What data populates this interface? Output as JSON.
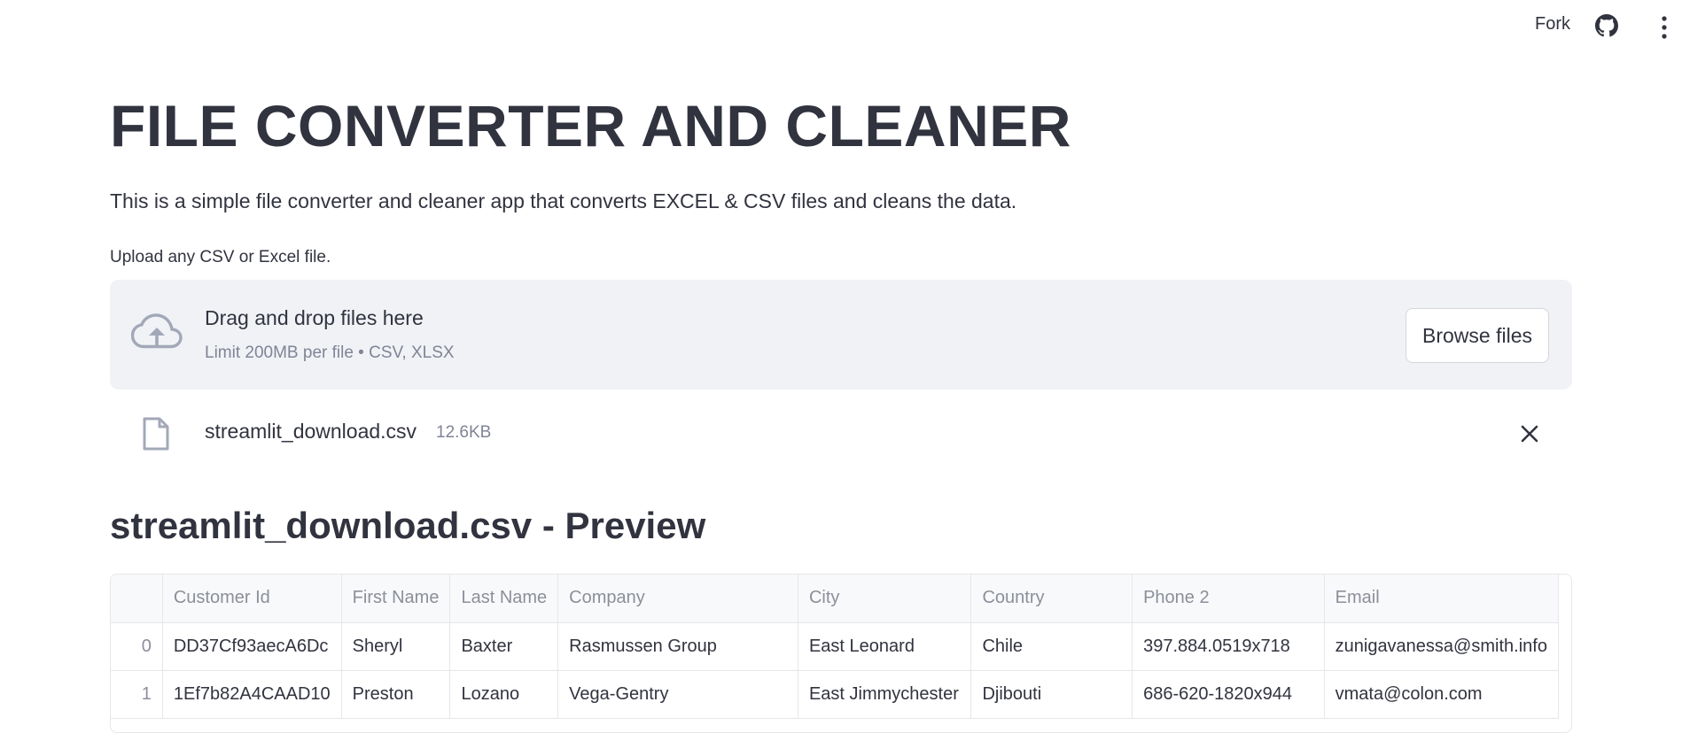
{
  "header": {
    "fork_label": "Fork",
    "icons": [
      "github-icon",
      "more-vert-icon"
    ]
  },
  "main": {
    "title": "FILE CONVERTER AND CLEANER",
    "description": "This is a simple file converter and cleaner app that converts EXCEL & CSV files and cleans the data.",
    "uploader": {
      "label": "Upload any CSV or Excel file.",
      "drop_text": "Drag and drop files here",
      "limit_text": "Limit 200MB per file • CSV, XLSX",
      "browse_label": "Browse files",
      "icon": "cloud-upload-icon"
    },
    "uploaded_file": {
      "name": "streamlit_download.csv",
      "size": "12.6KB",
      "icon": "file-icon"
    },
    "preview_title": "streamlit_download.csv - Preview",
    "table": {
      "columns": [
        "",
        "Customer Id",
        "First Name",
        "Last Name",
        "Company",
        "City",
        "Country",
        "Phone 2",
        "Email"
      ],
      "rows": [
        [
          "0",
          "DD37Cf93aecA6Dc",
          "Sheryl",
          "Baxter",
          "Rasmussen Group",
          "East Leonard",
          "Chile",
          "397.884.0519x718",
          "zunigavanessa@smith.info"
        ],
        [
          "1",
          "1Ef7b82A4CAAD10",
          "Preston",
          "Lozano",
          "Vega-Gentry",
          "East Jimmychester",
          "Djibouti",
          "686-620-1820x944",
          "vmata@colon.com"
        ]
      ]
    }
  }
}
